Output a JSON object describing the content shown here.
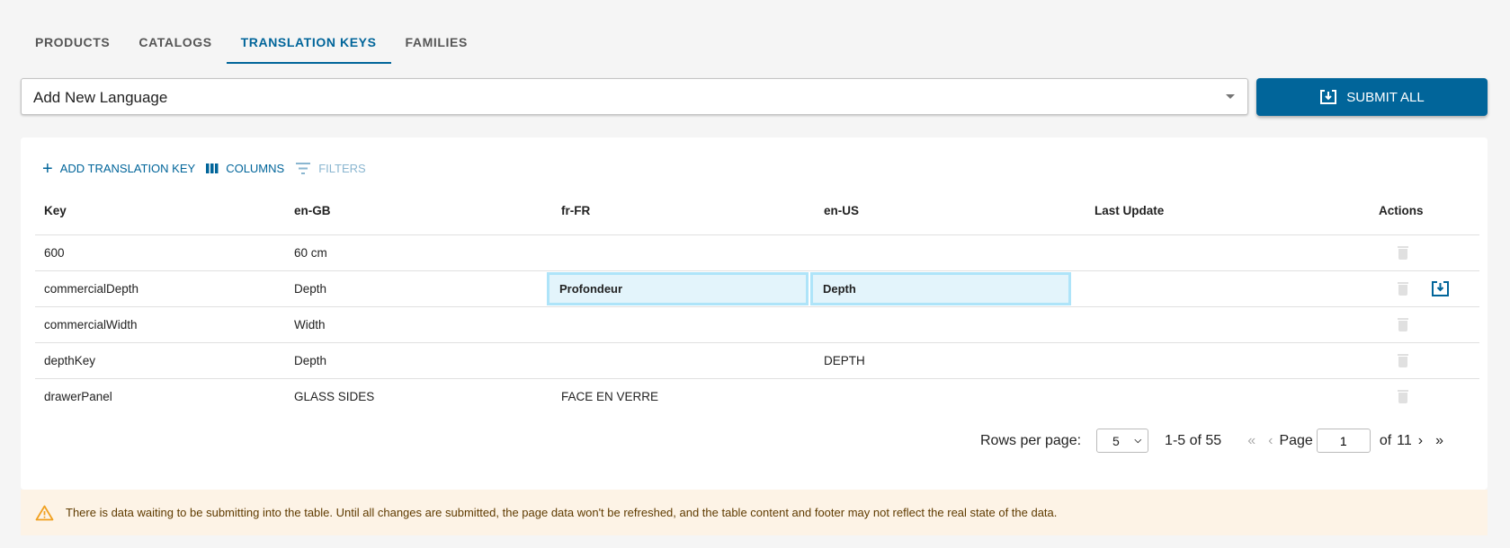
{
  "tabs": [
    {
      "label": "PRODUCTS"
    },
    {
      "label": "CATALOGS"
    },
    {
      "label": "TRANSLATION KEYS",
      "active": true
    },
    {
      "label": "FAMILIES"
    }
  ],
  "language_select": {
    "value": "Add New Language"
  },
  "submit_all": {
    "label": "SUBMIT ALL",
    "icon": "save-download-icon"
  },
  "toolbar": {
    "add": "ADD TRANSLATION KEY",
    "columns": "COLUMNS",
    "filters": "FILTERS"
  },
  "table": {
    "headers": [
      "Key",
      "en-GB",
      "fr-FR",
      "en-US",
      "Last Update",
      "Actions"
    ],
    "rows": [
      {
        "key": "600",
        "en_GB": "60 cm",
        "fr_FR": "",
        "en_US": "",
        "last_update": ""
      },
      {
        "key": "commercialDepth",
        "en_GB": "Depth",
        "fr_FR": "Profondeur",
        "en_US": "Depth",
        "last_update": "",
        "edited": true
      },
      {
        "key": "commercialWidth",
        "en_GB": "Width",
        "fr_FR": "",
        "en_US": "",
        "last_update": ""
      },
      {
        "key": "depthKey",
        "en_GB": "Depth",
        "fr_FR": "",
        "en_US": "DEPTH",
        "last_update": ""
      },
      {
        "key": "drawerPanel",
        "en_GB": "GLASS SIDES",
        "fr_FR": "FACE EN VERRE",
        "en_US": "",
        "last_update": ""
      }
    ]
  },
  "pagination": {
    "rows_label": "Rows per page:",
    "rows_value": "5",
    "range": "1-5 of 55",
    "page_label": "Page",
    "page": "1",
    "of_label": "of",
    "total_pages": "11"
  },
  "warning": {
    "text": "There is data waiting to be submitting into the table. Until all changes are submitted, the page data won't be refreshed, and the table content and footer may not reflect the real state of the data."
  },
  "colors": {
    "primary": "#01659a",
    "edit_bg": "#e3f4fb",
    "edit_border": "#aee4f9",
    "warning_bg": "#fdf3e6",
    "warning_icon": "#f0a020"
  }
}
